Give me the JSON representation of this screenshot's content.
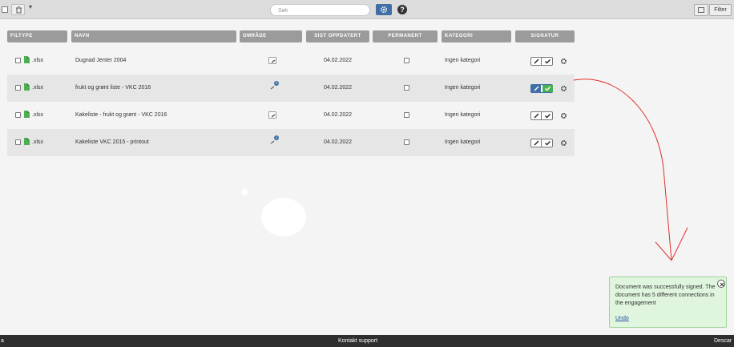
{
  "toolbar": {
    "search_placeholder": "Søk",
    "help_label": "?",
    "filter_label": "Filter",
    "caret": "▾"
  },
  "table": {
    "headers": [
      "FILTYPE",
      "NAVN",
      "OMRÅDE",
      "SIST OPPDATERT",
      "PERMANENT",
      "KATEGORI",
      "SIGNATUR"
    ],
    "rows": [
      {
        "filetype": ".xlsx",
        "name": "Dugnad Jenter 2004",
        "area_badge": "",
        "updated": "04.02.2022",
        "category": "Ingen kategori",
        "signed": false
      },
      {
        "filetype": ".xlsx",
        "name": "frukt og grønt liste - VKC 2016",
        "area_badge": "5",
        "updated": "04.02.2022",
        "category": "Ingen kategori",
        "signed": true
      },
      {
        "filetype": ".xlsx",
        "name": "Kakeliste - frukt og grønt - VKC 2016",
        "area_badge": "",
        "updated": "04.02.2022",
        "category": "Ingen kategori",
        "signed": false
      },
      {
        "filetype": ".xlsx",
        "name": "Kakeliste VKC 2015 - printout",
        "area_badge": "1",
        "updated": "04.02.2022",
        "category": "Ingen kategori",
        "signed": false
      }
    ]
  },
  "toast": {
    "message": "Document was successfully signed. The document has 5 different connections in the engagement",
    "undo_label": "Undo"
  },
  "footer": {
    "left": "a",
    "center": "Kontakt support",
    "right": "Descar"
  },
  "colors": {
    "header_bg": "#9b9b9b",
    "accent_blue": "#3f6fa6",
    "success_green": "#4caf50",
    "toast_bg": "#dff5dd",
    "annotation_red": "#e03030"
  }
}
